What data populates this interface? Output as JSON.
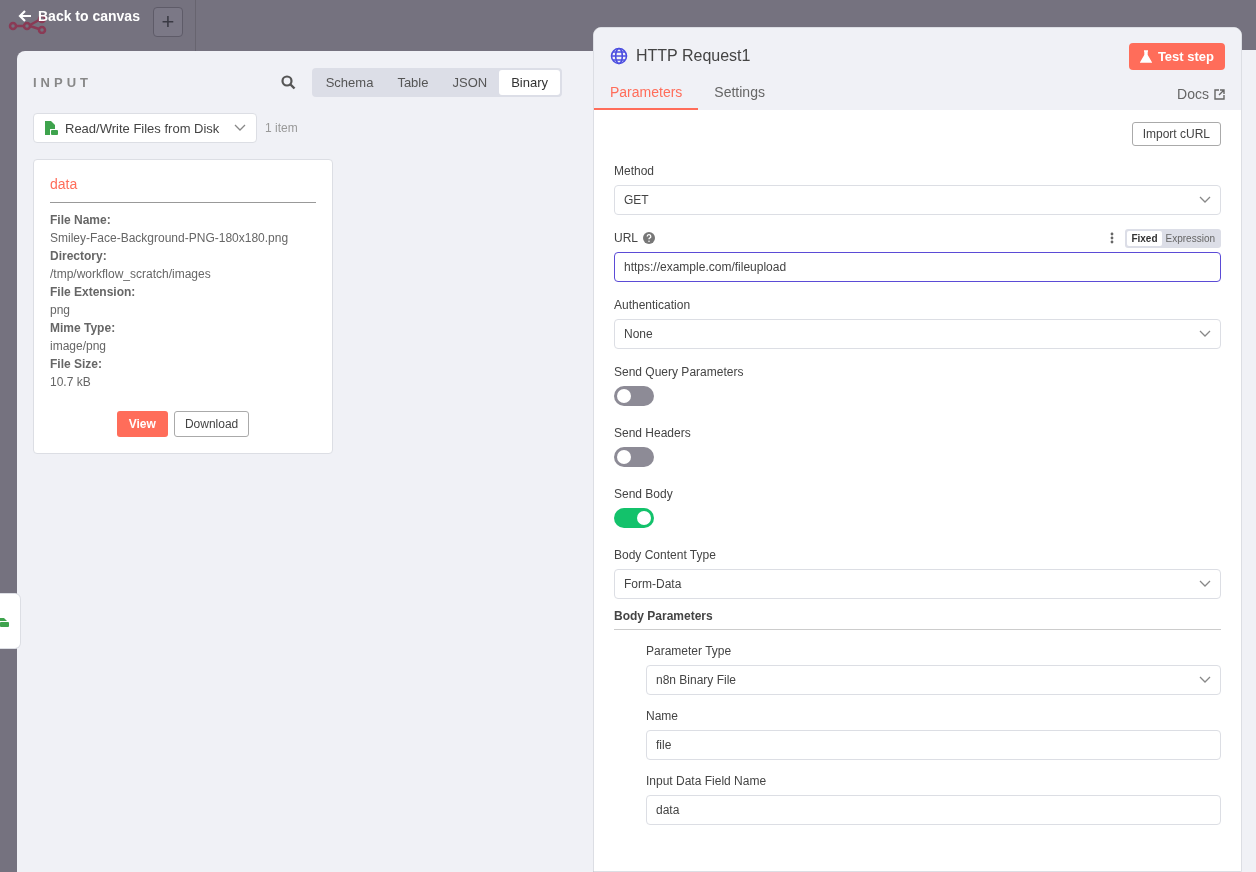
{
  "top_bar": {
    "back_link": "Back to canvas",
    "add_button": "+"
  },
  "input_panel": {
    "title": "INPUT",
    "view_tabs": [
      {
        "label": "Schema",
        "selected": false
      },
      {
        "label": "Table",
        "selected": false
      },
      {
        "label": "JSON",
        "selected": false
      },
      {
        "label": "Binary",
        "selected": true
      }
    ],
    "source_select": "Read/Write Files from Disk",
    "item_count": "1 item",
    "binary_card": {
      "title": "data",
      "fields": [
        {
          "label": "File Name:",
          "value": "Smiley-Face-Background-PNG-180x180.png"
        },
        {
          "label": "Directory:",
          "value": "/tmp/workflow_scratch/images"
        },
        {
          "label": "File Extension:",
          "value": "png"
        },
        {
          "label": "Mime Type:",
          "value": "image/png"
        },
        {
          "label": "File Size:",
          "value": "10.7 kB"
        }
      ],
      "buttons": [
        "View",
        "Download"
      ]
    }
  },
  "node_panel": {
    "title": "HTTP Request1",
    "test_button": "Test step",
    "tabs": [
      {
        "label": "Parameters",
        "selected": true
      },
      {
        "label": "Settings",
        "selected": false
      }
    ],
    "docs_link": "Docs",
    "import_button": "Import cURL",
    "parameters": [
      {
        "kind": "select",
        "label": "Method",
        "value": "GET"
      },
      {
        "kind": "input",
        "label": "URL",
        "help": true,
        "value": "https://example.com/fileupload",
        "focused": true,
        "modes": [
          {
            "label": "Fixed",
            "selected": true
          },
          {
            "label": "Expression",
            "selected": false
          }
        ]
      },
      {
        "kind": "select",
        "label": "Authentication",
        "value": "None"
      },
      {
        "kind": "toggle",
        "label": "Send Query Parameters",
        "on": false
      },
      {
        "kind": "toggle",
        "label": "Send Headers",
        "on": false
      },
      {
        "kind": "toggle",
        "label": "Send Body",
        "on": true
      },
      {
        "kind": "select",
        "label": "Body Content Type",
        "value": "Form-Data"
      },
      {
        "kind": "section",
        "label": "Body Parameters",
        "children": [
          {
            "kind": "select",
            "label": "Parameter Type",
            "value": "n8n Binary File"
          },
          {
            "kind": "input",
            "label": "Name",
            "value": "file"
          },
          {
            "kind": "input",
            "label": "Input Data Field Name",
            "value": "data"
          }
        ]
      }
    ]
  }
}
